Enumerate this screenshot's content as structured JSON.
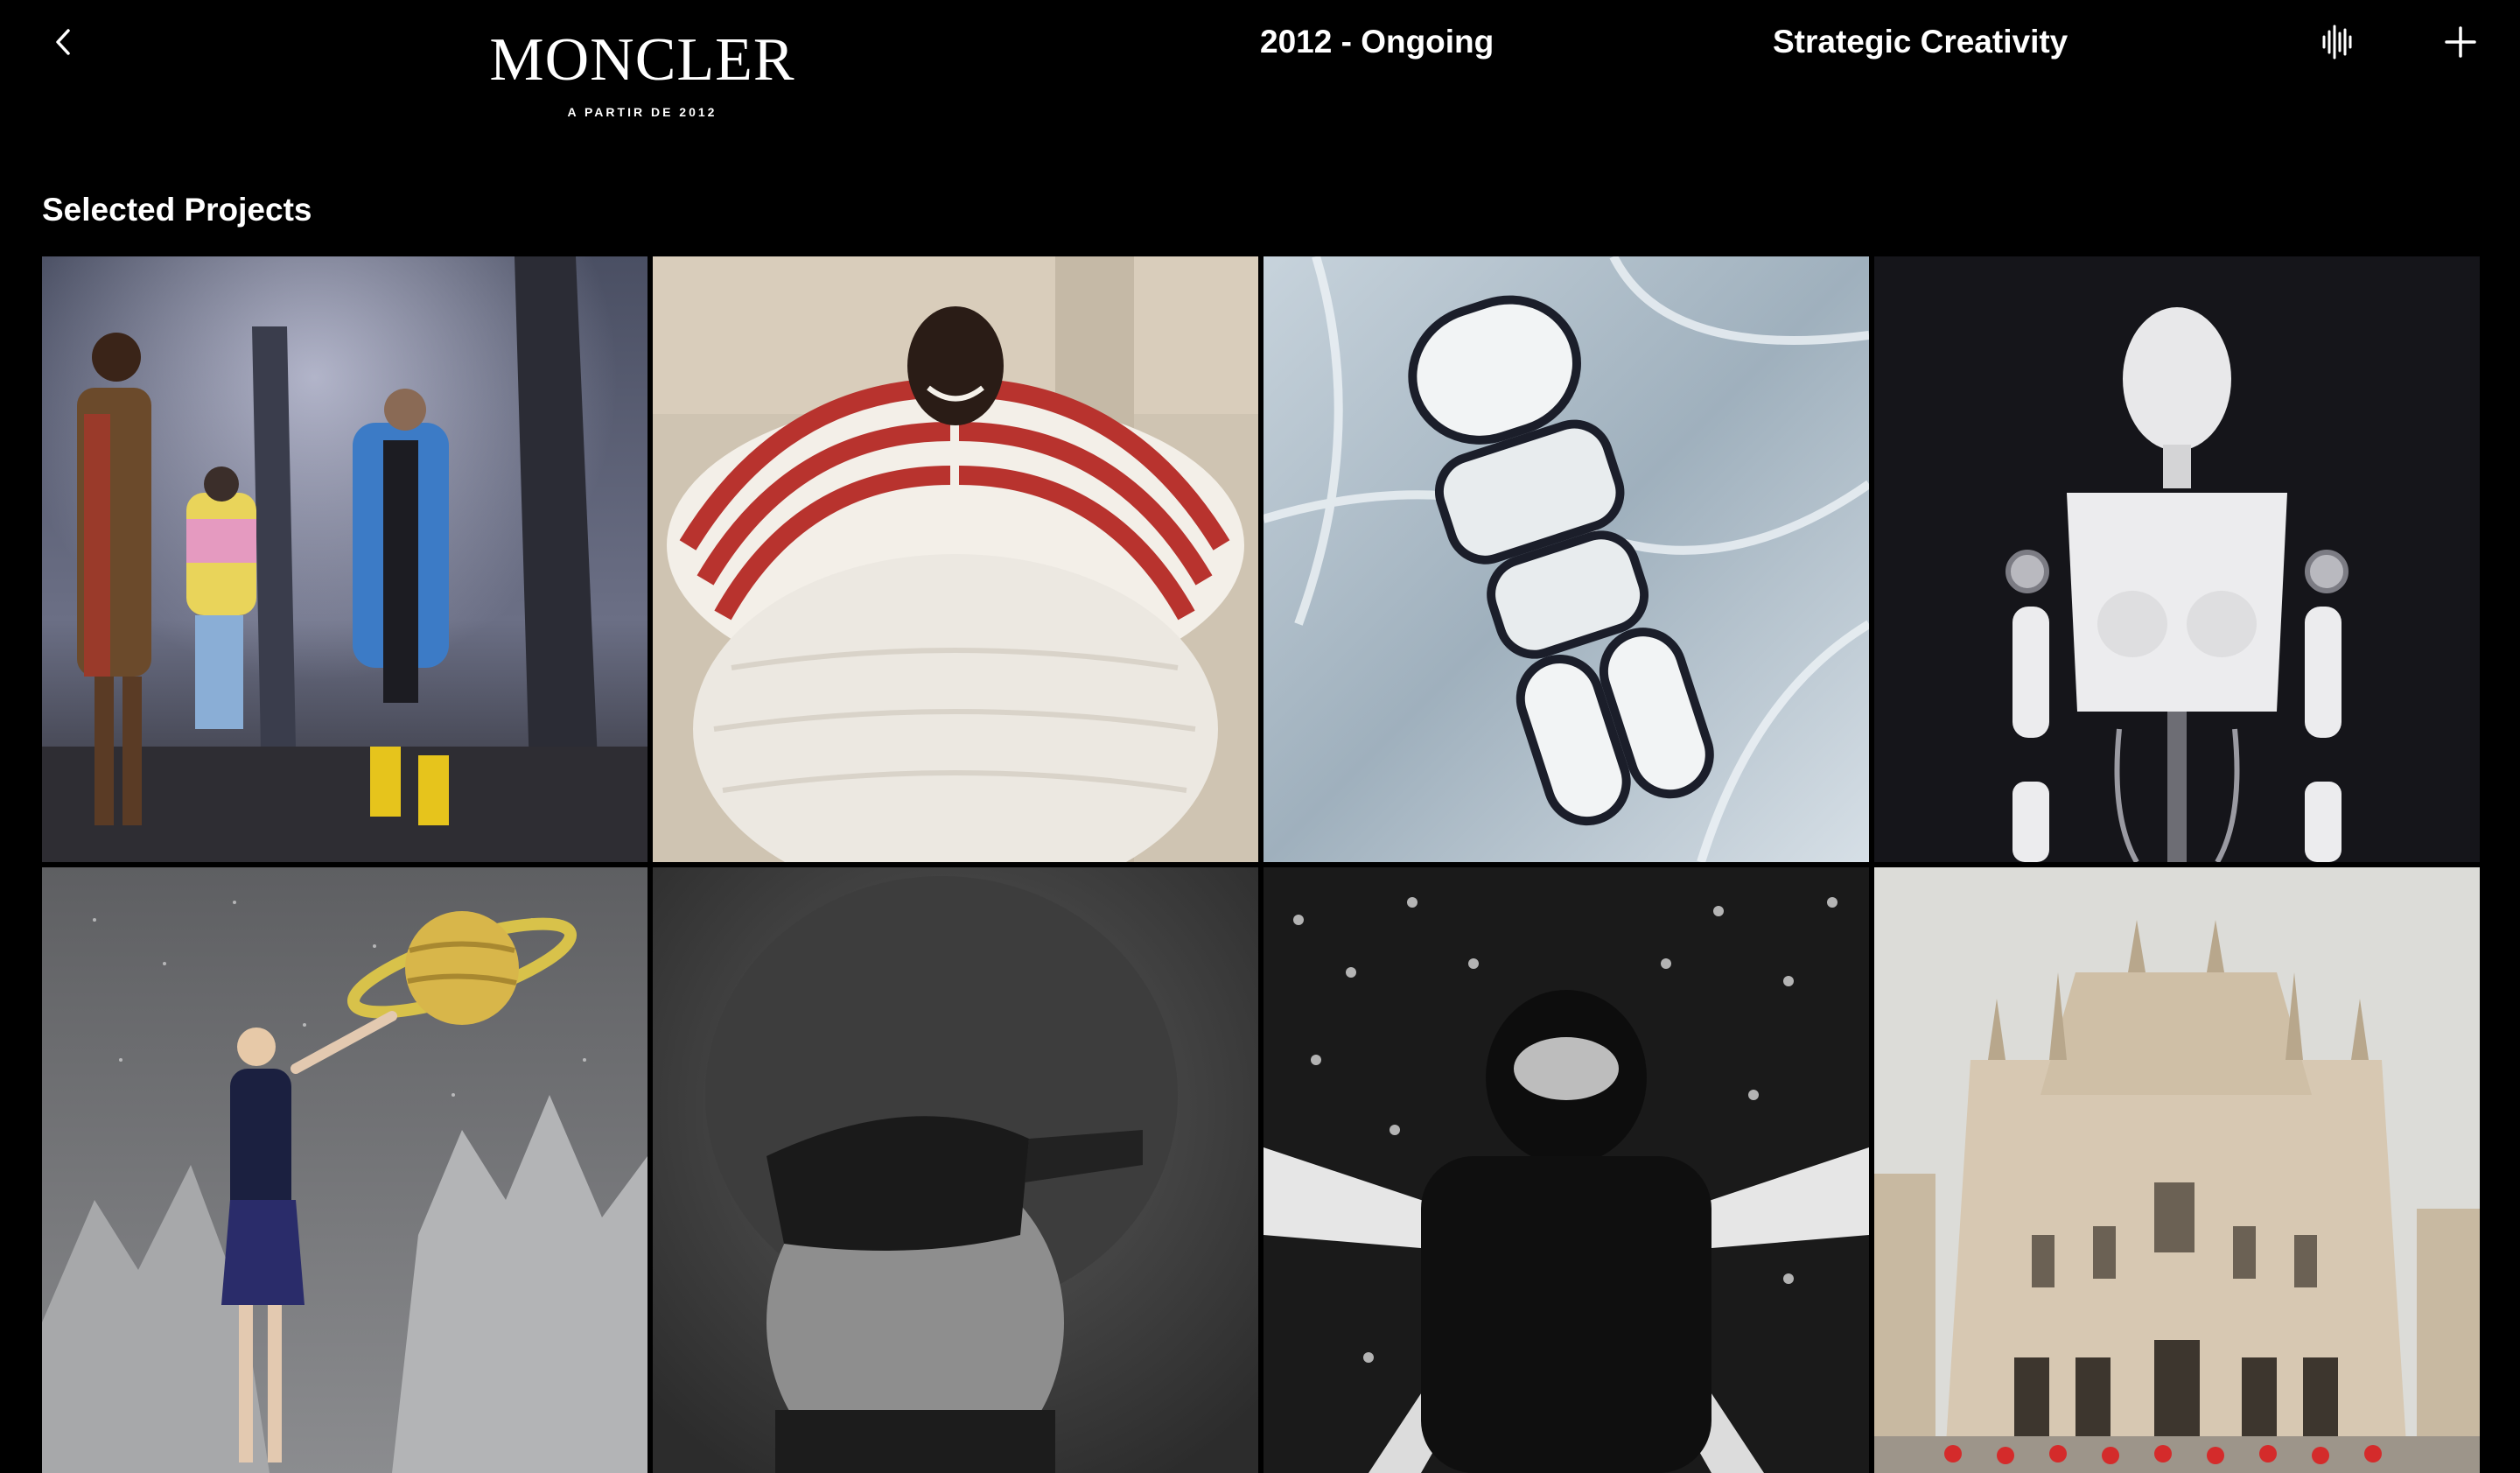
{
  "header": {
    "logo_text": "MONCLER",
    "logo_subtitle": "A PARTIR DE 2012",
    "period": "2012 - Ongoing",
    "category": "Strategic Creativity",
    "icons": {
      "back": "chevron-left-icon",
      "audio": "audio-wave-icon",
      "add": "plus-icon"
    }
  },
  "main": {
    "section_title": "Selected Projects",
    "projects": [
      {
        "subject": "runway-show"
      },
      {
        "subject": "striped-puffer-coat"
      },
      {
        "subject": "sneaker-sole-on-ice"
      },
      {
        "subject": "robot-mannequin"
      },
      {
        "subject": "saturn-fantasy"
      },
      {
        "subject": "ski-goggles-portrait"
      },
      {
        "subject": "star-tunnel-balaclava"
      },
      {
        "subject": "milan-cathedral"
      }
    ]
  }
}
